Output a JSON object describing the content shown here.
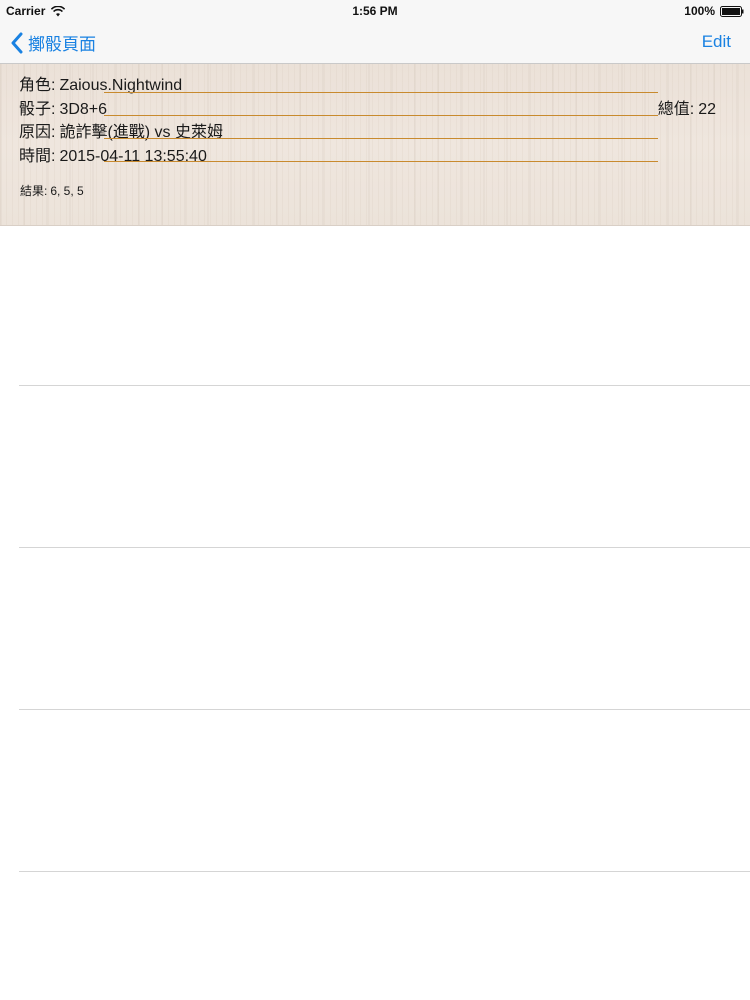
{
  "status_bar": {
    "carrier": "Carrier",
    "time": "1:56 PM",
    "battery_percent": "100%",
    "battery_level": 1.0
  },
  "nav_bar": {
    "back_label": "擲骰頁面",
    "edit_label": "Edit"
  },
  "roll": {
    "character_label": "角色:",
    "character_value": "Zaious.Nightwind",
    "dice_label": "骰子:",
    "dice_value": "3D8+6",
    "total_label": "總值:",
    "total_value": "22",
    "reason_label": "原因:",
    "reason_value": "詭詐擊(進戰) vs 史萊姆",
    "time_label": "時間:",
    "time_value": "2015-04-11 13:55:40",
    "result_label": "結果:",
    "result_value": "6, 5, 5"
  },
  "colors": {
    "accent": "#1a82e2",
    "underline": "#c88a2e"
  }
}
